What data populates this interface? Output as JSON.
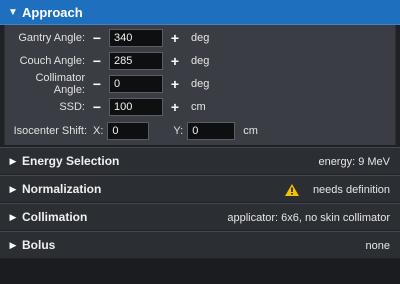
{
  "approach": {
    "title": "Approach",
    "gantry": {
      "label": "Gantry Angle:",
      "value": "340",
      "unit": "deg"
    },
    "couch": {
      "label": "Couch Angle:",
      "value": "285",
      "unit": "deg"
    },
    "collimator": {
      "label": "Collimator Angle:",
      "value": "0",
      "unit": "deg"
    },
    "ssd": {
      "label": "SSD:",
      "value": "100",
      "unit": "cm"
    },
    "shift": {
      "label": "Isocenter Shift:",
      "x_label": "X:",
      "x_value": "0",
      "y_label": "Y:",
      "y_value": "0",
      "unit": "cm"
    },
    "minus": "−",
    "plus": "+"
  },
  "sections": {
    "energy": {
      "title": "Energy Selection",
      "status": "energy: 9 MeV"
    },
    "normalization": {
      "title": "Normalization",
      "status": "needs definition",
      "status_icon": "warning-icon",
      "icon_color": "#f2c300"
    },
    "collimation": {
      "title": "Collimation",
      "status": "applicator: 6x6, no skin collimator"
    },
    "bolus": {
      "title": "Bolus",
      "status": "none"
    }
  },
  "colors": {
    "accent": "#1f6fbf"
  }
}
